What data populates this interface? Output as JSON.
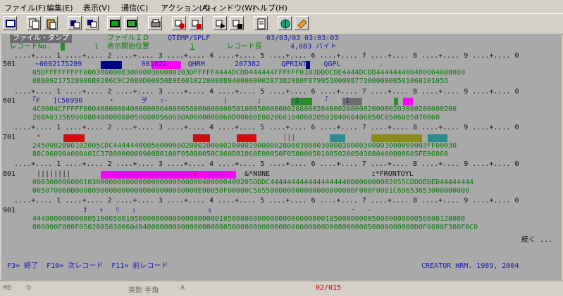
{
  "menu": [
    {
      "label": "ファイル(F)"
    },
    {
      "label": "編集(E)"
    },
    {
      "label": "表示(V)"
    },
    {
      "label": "通信(C)"
    },
    {
      "label": "アクション(A)"
    },
    {
      "label": "ウィンドウ(W)"
    },
    {
      "label": "ヘルプ(H)"
    }
  ],
  "toolbar_icons": [
    "terminal-icon",
    "copy-icon",
    "paste-icon",
    "clipboard-icon",
    "screen-icon",
    "display-icon",
    "record-icon",
    "record-stop-icon",
    "play-icon",
    "play-stop-icon",
    "macro-icon",
    "document-icon",
    "network-icon",
    "tag-icon"
  ],
  "header": {
    "title": "ファイル・ダンプ",
    "file_id_label": "ファイルＩＤ",
    "file_id": "QTEMP/SPLF",
    "datetime": "03/03/03 03:03:03",
    "record_no_label": "レコードNo.",
    "record_no": "1",
    "display_start_label": "表示開始位置",
    "display_start": "1",
    "record_len_label": "レコード長",
    "record_len": "4,083 バイト"
  },
  "ruler": " ....+.... 1 ....+.... 2 ....+.... 3 ....+.... 4 ....+.... 5 ....+.... 6 ....+.... 7 ....+.... 8 ....+.... 9 ....+.... 0",
  "blocks": [
    {
      "pos": "501",
      "text": "~0092175289              001022     QHRM       207382     QPRINT    QGPL         .",
      "hex1": "05DFFFFFFFFF0003000000300000300000103DFFFFF4444DCDD444444FFFFFF0103DDDCDE4444DCDD444444400400004000000",
      "hex2": "08809217528906B0206C0C2080D00050E0E60102200088940000000207382080F87995300008773000000050106010105O"
    },
    {
      "pos": "601",
      "text": "｢F   ]C56990      ・      ヲ   ｯ-             )       ;        I      ｢    I                    ",
      "hex1": "4C0004CFFFFF0004000000400000000400005600000000050100050000000208000204000208000200000203000200000200",
      "hex2": "260A03356990080400000080500000560600A0600000060D00080E0020601040602050304060406050C0506005070060"
    },
    {
      "pos": "701",
      "text": " *                                                         |||                               ",
      "hex1": "2450002000102005CDC44444400050000000200020000020000200000028000380003000030000300003000000003FF00030",
      "hex2": "80C06090A000A01C3780000000900B0100F050B0050C060D01060E00050F0500005010050200503080400000605FE06060"
    },
    {
      "pos": "801",
      "text": " ||||||||                             +           &*NONE                        ｪ*FRONTOYL      ",
      "hex1": "0003000060001030000000000000000000000000400000400205DDDC44444444444444444400000000002055CDDDEDED44444444",
      "hex2": "005070060B00080900000000000000000000000E00050F00000C565500000000000000000000F000F0001C69653653000000000"
    },
    {
      "pos": "901",
      "text": "            ｵ   ｬ   ﾘ   ｭ                 ｮ                                 ｰ   -",
      "hex1": "444000000000005100058010500000000000000000001050000000000000000000000105000000005000000000050600120000",
      "hex2": "000000F000F0502005030060404000000000000000000850000000000000000000000D00800000050000000000D0F0600F300F0C0"
    }
  ],
  "more": "続く ...",
  "fkeys": "F3= 終了  F10= 次レコード  F11= 前レコード",
  "creator": "CREATOR HRM. 1989, 2004",
  "statusbar": {
    "mode": "MB",
    "b": "b",
    "ime": "英数 半角",
    "a": "A",
    "page": "02/015"
  },
  "colors": {
    "screen_bg": "#a9a9a9",
    "text_green": "#0a7a0a",
    "text_blue": "#1a1aa8",
    "magenta": "#ff00ff",
    "navy": "#000080",
    "red": "#cc1010",
    "green_block": "#2e8b2e",
    "olive": "#8b8b1a",
    "teal": "#2e8b8b"
  }
}
